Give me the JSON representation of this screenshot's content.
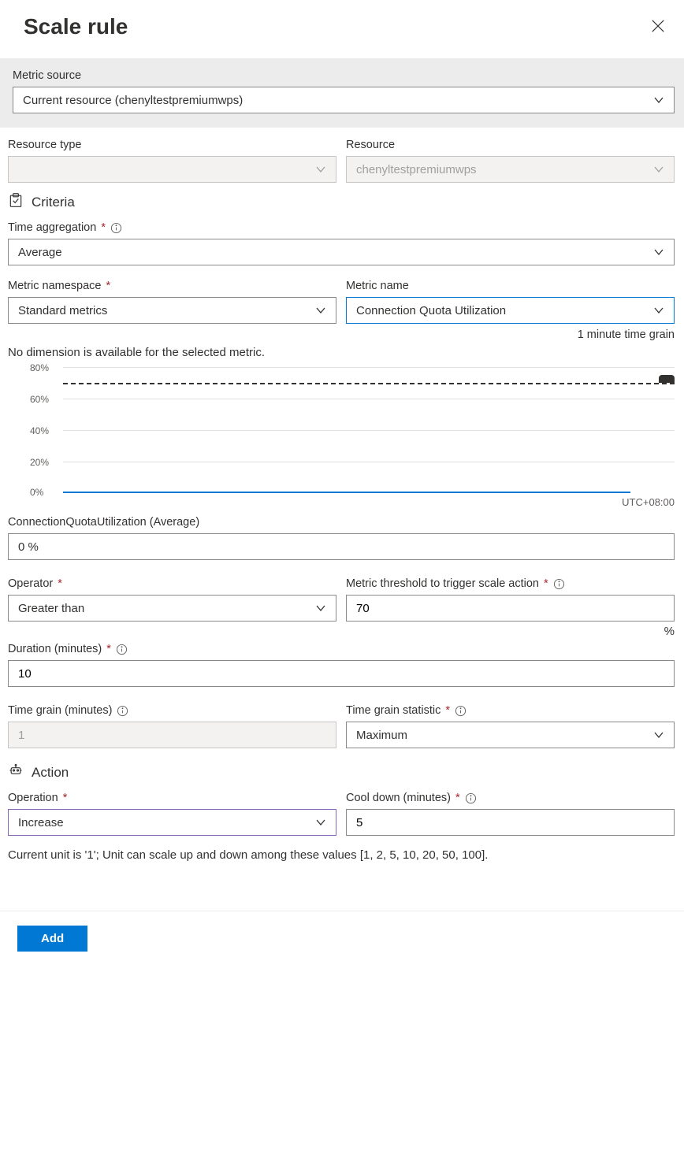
{
  "title": "Scale rule",
  "metric_source": {
    "label": "Metric source",
    "value": "Current resource (chenyltestpremiumwps)"
  },
  "resource_type": {
    "label": "Resource type",
    "value": ""
  },
  "resource": {
    "label": "Resource",
    "value": "chenyltestpremiumwps"
  },
  "criteria": {
    "heading": "Criteria",
    "time_aggregation": {
      "label": "Time aggregation",
      "value": "Average"
    },
    "metric_namespace": {
      "label": "Metric namespace",
      "value": "Standard metrics"
    },
    "metric_name": {
      "label": "Metric name",
      "value": "Connection Quota Utilization",
      "hint": "1 minute time grain"
    },
    "no_dimension": "No dimension is available for the selected metric.",
    "current_label": "ConnectionQuotaUtilization (Average)",
    "current_value": "0 %",
    "operator": {
      "label": "Operator",
      "value": "Greater than"
    },
    "threshold": {
      "label": "Metric threshold to trigger scale action",
      "value": "70",
      "unit": "%"
    },
    "duration": {
      "label": "Duration (minutes)",
      "value": "10"
    },
    "time_grain": {
      "label": "Time grain (minutes)",
      "value": "1"
    },
    "time_grain_statistic": {
      "label": "Time grain statistic",
      "value": "Maximum"
    }
  },
  "action": {
    "heading": "Action",
    "operation": {
      "label": "Operation",
      "value": "Increase"
    },
    "cooldown": {
      "label": "Cool down (minutes)",
      "value": "5"
    },
    "unit_info": "Current unit is '1'; Unit can scale up and down among these values [1, 2, 5, 10, 20, 50, 100]."
  },
  "chart_data": {
    "type": "line",
    "series": [
      {
        "name": "ConnectionQuotaUtilization (Average)",
        "values": [
          0,
          0,
          0,
          0,
          0,
          0,
          0,
          0,
          0,
          0
        ]
      }
    ],
    "threshold": 70,
    "ylabel": "%",
    "ylim": [
      0,
      80
    ],
    "y_ticks": [
      "0%",
      "20%",
      "40%",
      "60%",
      "80%"
    ],
    "timezone": "UTC+08:00"
  },
  "footer": {
    "add": "Add"
  }
}
